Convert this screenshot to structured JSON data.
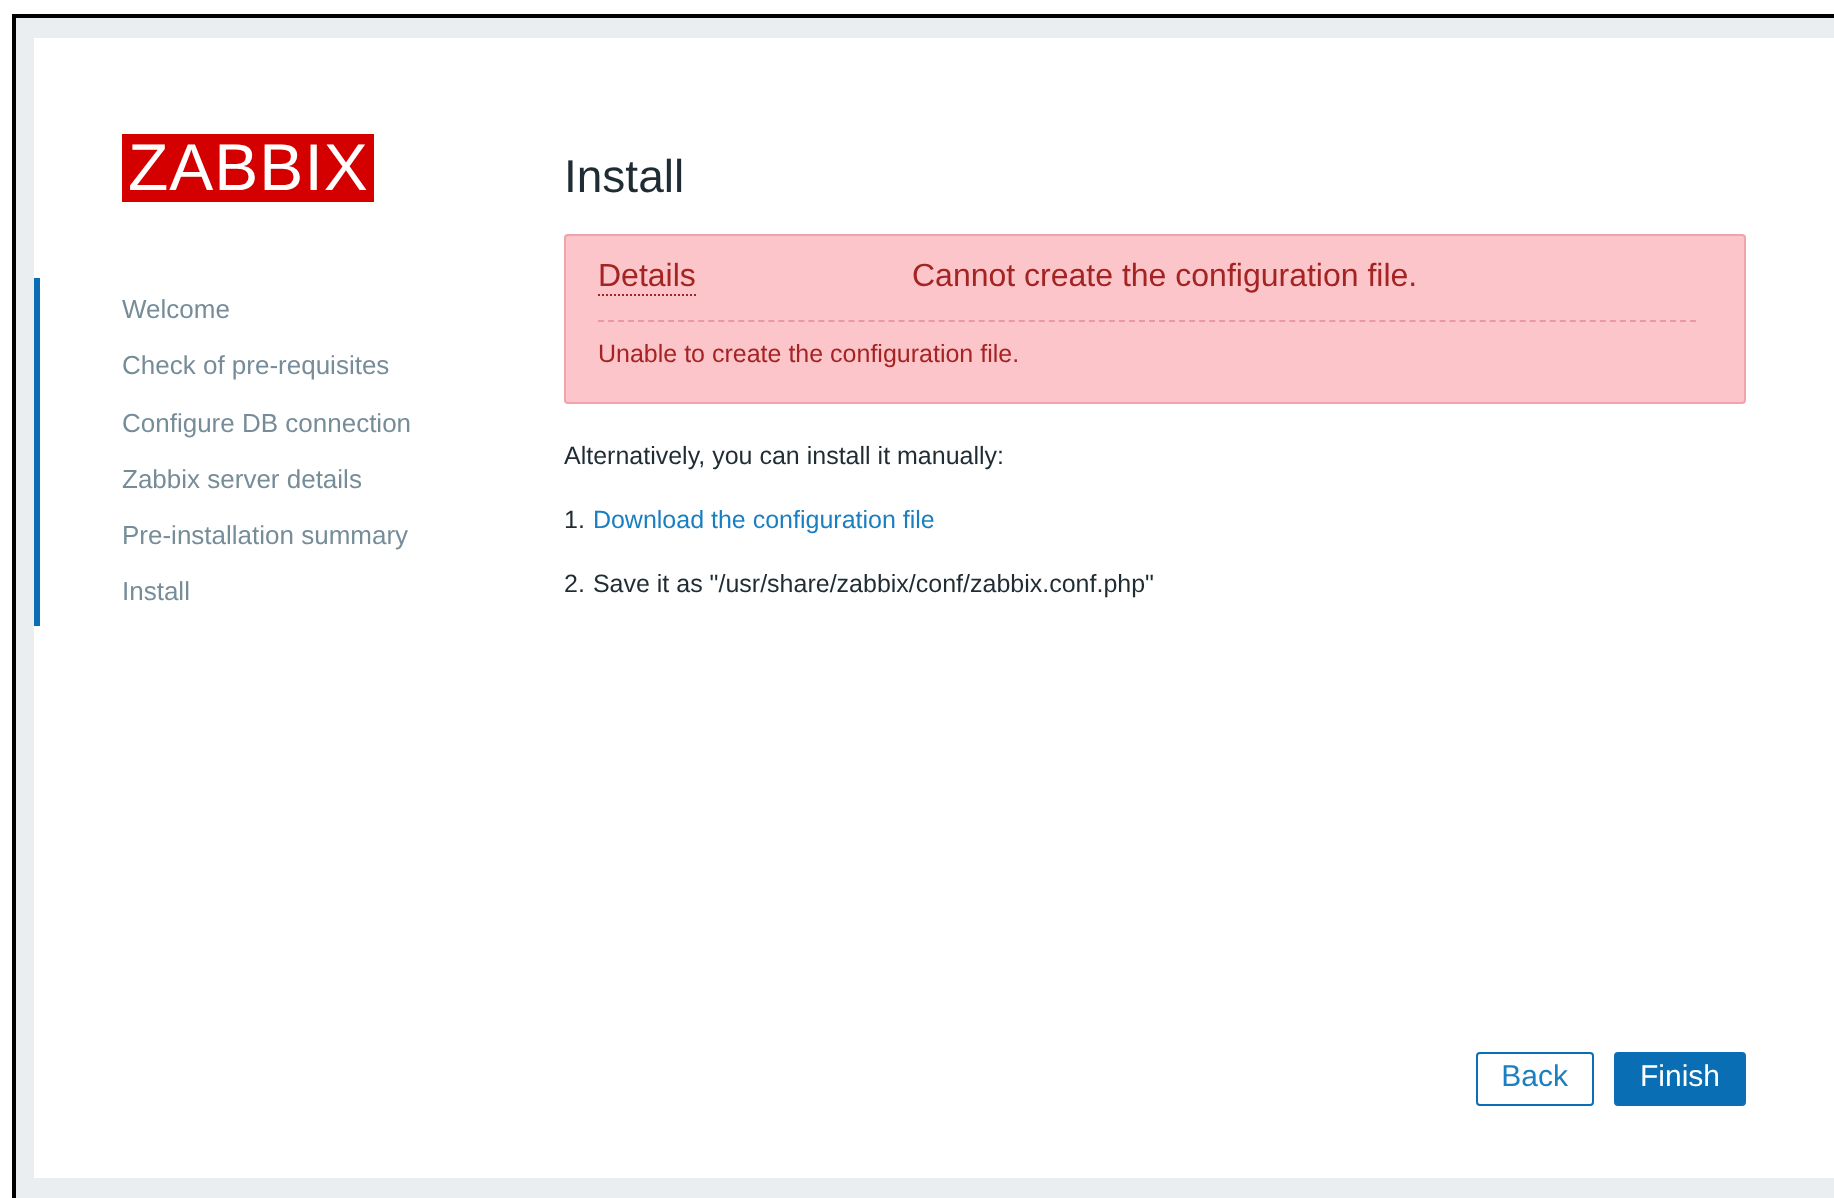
{
  "logo": "ZABBIX",
  "steps": [
    "Welcome",
    "Check of pre-requisites",
    "Configure DB connection",
    "Zabbix server details",
    "Pre-installation summary",
    "Install"
  ],
  "title": "Install",
  "alert": {
    "link": "Details",
    "message": "Cannot create the configuration file.",
    "detail": "Unable to create the configuration file."
  },
  "intro": "Alternatively, you can install it manually:",
  "instructions": [
    {
      "number": "1.",
      "link": "Download the configuration file"
    },
    {
      "number": "2.",
      "text": "Save it as \"/usr/share/zabbix/conf/zabbix.conf.php\""
    }
  ],
  "buttons": [
    {
      "label": "Back",
      "kind": "secondary"
    },
    {
      "label": "Finish",
      "kind": "primary"
    }
  ]
}
